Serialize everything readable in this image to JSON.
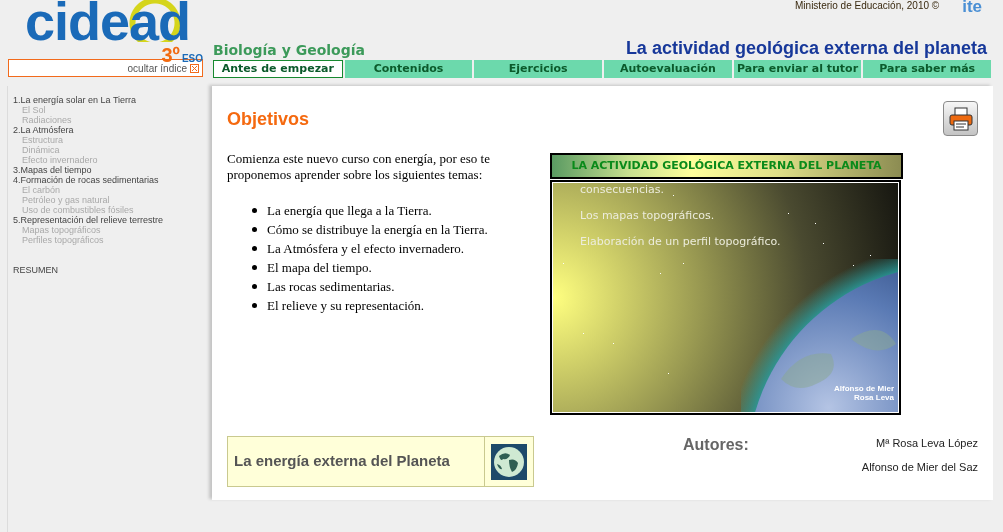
{
  "header": {
    "logo": {
      "wordmark": "cidead",
      "grade": "3º",
      "stage": "ESO"
    },
    "copyright": "Ministerio de Educación, 2010 ©",
    "publisher_logo": "ite",
    "subject": "Biología y Geología",
    "title": "La actividad geológica externa del planeta"
  },
  "index_toggle": {
    "label": "ocultar índice"
  },
  "tabs": [
    {
      "label": "Antes de empezar",
      "selected": true
    },
    {
      "label": "Contenidos",
      "selected": false
    },
    {
      "label": "Ejercicios",
      "selected": false
    },
    {
      "label": "Autoevaluación",
      "selected": false
    },
    {
      "label": "Para enviar al tutor",
      "selected": false
    },
    {
      "label": "Para saber más",
      "selected": false
    }
  ],
  "sidebar": {
    "items": [
      {
        "label": "1.La energía solar en La Tierra",
        "children": [
          {
            "label": "El Sol"
          },
          {
            "label": "Radiaciones"
          }
        ]
      },
      {
        "label": "2.La Atmósfera",
        "children": [
          {
            "label": "Estructura"
          },
          {
            "label": "Dinámica"
          },
          {
            "label": "Efecto invernadero"
          }
        ]
      },
      {
        "label": "3.Mapas del tiempo"
      },
      {
        "label": "4.Formación de rocas sedimentarias",
        "children": [
          {
            "label": "El carbón"
          },
          {
            "label": "Petróleo y gas natural"
          },
          {
            "label": "Uso de combustibles fósiles"
          }
        ]
      },
      {
        "label": "5.Representación del relieve terrestre",
        "children": [
          {
            "label": "Mapas topográficos"
          },
          {
            "label": "Perfiles topográficos"
          }
        ]
      }
    ],
    "summary": "RESUMEN"
  },
  "content": {
    "heading": "Objetivos",
    "intro": "Comienza este nuevo curso con energía, por eso te proponemos aprender sobre los siguientes temas:",
    "topics": [
      "La energía que llega a la Tierra.",
      "Cómo se distribuye la energía en la Tierra.",
      "La Atmósfera y el efecto invernadero.",
      "El mapa del tiempo.",
      "Las rocas sedimentarias.",
      "El relieve y su representación."
    ],
    "presentation": {
      "title": "LA ACTIVIDAD GEOLÓGICA EXTERNA DEL PLANETA",
      "slide_lines": [
        "consecuencias.",
        "Los mapas topográficos.",
        "Elaboración de un perfil topográfico."
      ],
      "credit": [
        "Alfonso de Mier",
        "Rosa Leva"
      ]
    },
    "unit_link": {
      "label": "La energía externa del Planeta"
    },
    "authors": {
      "heading": "Autores:",
      "names": [
        "Mª Rosa Leva López",
        "Alfonso de Mier del Saz"
      ]
    }
  }
}
